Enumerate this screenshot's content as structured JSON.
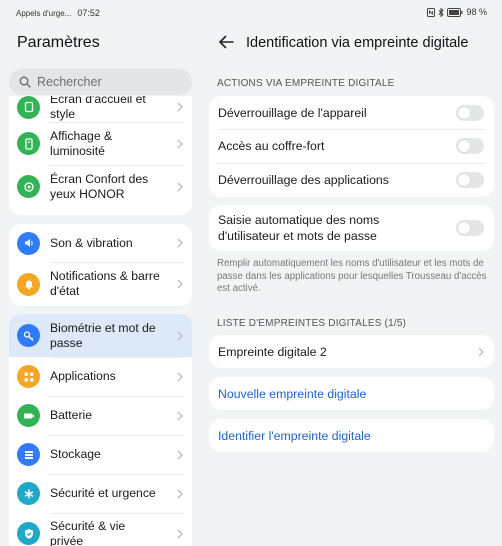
{
  "status_left": {
    "carrier": "Appels d'urge...",
    "time": "07:52"
  },
  "status_right": {
    "battery": "98 %"
  },
  "left": {
    "title": "Paramètres",
    "search_placeholder": "Rechercher",
    "groups": [
      {
        "items": [
          {
            "label": "Écran d'accueil et style",
            "icon": "home-screen-icon",
            "color": "#34b356"
          },
          {
            "label": "Affichage & luminosité",
            "icon": "display-icon",
            "color": "#34b356"
          },
          {
            "label": "Écran Confort des yeux HONOR",
            "icon": "eye-comfort-icon",
            "color": "#34b356"
          }
        ]
      },
      {
        "items": [
          {
            "label": "Son & vibration",
            "icon": "sound-icon",
            "color": "#2f7cf6"
          },
          {
            "label": "Notifications & barre d'état",
            "icon": "bell-icon",
            "color": "#f5a623"
          }
        ]
      },
      {
        "items": [
          {
            "label": "Biométrie et mot de passe",
            "icon": "key-icon",
            "color": "#2f7cf6",
            "selected": true
          },
          {
            "label": "Applications",
            "icon": "apps-icon",
            "color": "#f5a623"
          },
          {
            "label": "Batterie",
            "icon": "battery-icon",
            "color": "#34b356"
          },
          {
            "label": "Stockage",
            "icon": "storage-icon",
            "color": "#2f7cf6"
          },
          {
            "label": "Sécurité et urgence",
            "icon": "emergency-icon",
            "color": "#20a8c6"
          },
          {
            "label": "Sécurité & vie privée",
            "icon": "shield-icon",
            "color": "#20a8c6"
          }
        ]
      }
    ]
  },
  "right": {
    "title": "Identification via empreinte digitale",
    "section1": "ACTIONS VIA EMPREINTE DIGITALE",
    "toggles": [
      {
        "label": "Déverrouillage de l'appareil",
        "on": false
      },
      {
        "label": "Accès au coffre-fort",
        "on": false
      },
      {
        "label": "Déverrouillage des applications",
        "on": false
      }
    ],
    "autofill": {
      "label": "Saisie automatique des noms d'utilisateur et mots de passe",
      "on": false
    },
    "description": "Remplir automatiquement les noms d'utilisateur et les mots de passe dans les applications pour lesquelles Trousseau d'accès est activé.",
    "section2": "LISTE D'EMPREINTES DIGITALES (1/5)",
    "fingerprint": "Empreinte digitale 2",
    "new_fingerprint": "Nouvelle empreinte digitale",
    "identify": "Identifier l'empreinte digitale"
  }
}
